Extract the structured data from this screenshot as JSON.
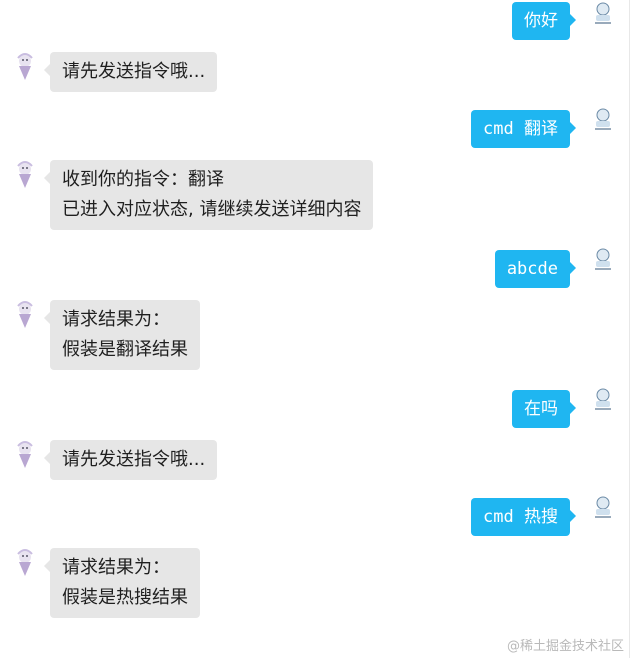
{
  "messages": [
    {
      "from": "me",
      "text": "你好"
    },
    {
      "from": "bot",
      "lines": [
        "请先发送指令哦..."
      ]
    },
    {
      "from": "me",
      "text": "cmd 翻译"
    },
    {
      "from": "bot",
      "lines": [
        "收到你的指令：翻译",
        "已进入对应状态, 请继续发送详细内容"
      ]
    },
    {
      "from": "me",
      "text": "abcde"
    },
    {
      "from": "bot",
      "lines": [
        "请求结果为：",
        "假装是翻译结果"
      ]
    },
    {
      "from": "me",
      "text": "在吗"
    },
    {
      "from": "bot",
      "lines": [
        "请先发送指令哦..."
      ]
    },
    {
      "from": "me",
      "text": "cmd 热搜"
    },
    {
      "from": "bot",
      "lines": [
        "请求结果为：",
        "假装是热搜结果"
      ]
    }
  ],
  "watermark": "@稀土掘金技术社区",
  "colors": {
    "me_bubble": "#1fb6f1",
    "bot_bubble": "#e6e6e6",
    "bot_text": "#1f1f1f",
    "me_text": "#ffffff"
  }
}
